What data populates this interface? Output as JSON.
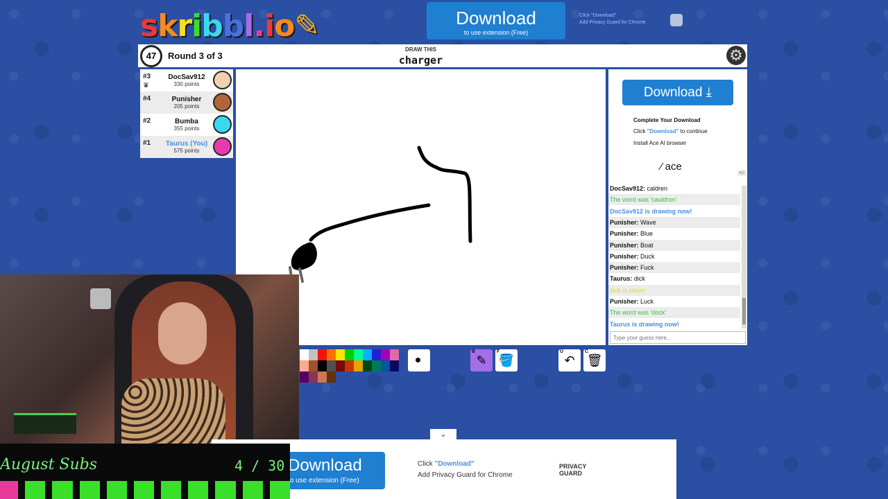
{
  "logo": {
    "letters": [
      {
        "ch": "s",
        "color": "#e83a3a"
      },
      {
        "ch": "k",
        "color": "#f58a1f"
      },
      {
        "ch": "r",
        "color": "#f5e11f"
      },
      {
        "ch": "i",
        "color": "#3adf2a"
      },
      {
        "ch": "b",
        "color": "#3ad7f0"
      },
      {
        "ch": "b",
        "color": "#4a6fe0"
      },
      {
        "ch": "l",
        "color": "#a46ee8"
      },
      {
        "ch": ".",
        "color": "#e83a9c"
      },
      {
        "ch": "i",
        "color": "#e83a3a"
      },
      {
        "ch": "o",
        "color": "#f58a1f"
      },
      {
        "ch": "✎",
        "color": "#f5b01f"
      }
    ]
  },
  "top_ad": {
    "button_label": "Download",
    "button_sub": "to use extension (Free)",
    "side_line1": "Click \"Download\"",
    "side_line2": "Add Privacy Guard for Chrome"
  },
  "header": {
    "timer": "47",
    "round": "Round 3 of 3",
    "draw_this": "DRAW THIS",
    "word": "charger",
    "settings_icon": "⚙"
  },
  "players": [
    {
      "rank": "#3",
      "name": "DocSav912",
      "points": "330 points",
      "avatar_color": "#f0d0b0",
      "you": false,
      "crown": true
    },
    {
      "rank": "#4",
      "name": "Punisher",
      "points": "205 points",
      "avatar_color": "#b0653a",
      "you": false,
      "crown": false
    },
    {
      "rank": "#2",
      "name": "Bumba",
      "points": "355 points",
      "avatar_color": "#3ad7f0",
      "you": false,
      "crown": false
    },
    {
      "rank": "#1",
      "name": "Taurus (You)",
      "points": "575 points",
      "avatar_color": "#e83ab0",
      "you": true,
      "crown": false
    }
  ],
  "right_ad": {
    "button_label": "Download ⤓",
    "complete": "Complete Your Download",
    "click_prefix": "Click ",
    "click_link": "\"Download\"",
    "click_suffix": " to continue",
    "install": "Install Ace AI browser",
    "brand": "⁄ ace",
    "ad_label": "AD"
  },
  "chat": [
    {
      "user": "DocSav912:",
      "text": " caldren",
      "style": "normal"
    },
    {
      "user": "",
      "text": "The word was 'cauldron'",
      "style": "green"
    },
    {
      "user": "",
      "text": "DocSav912 is drawing now!",
      "style": "blue"
    },
    {
      "user": "Punisher:",
      "text": " Wave",
      "style": "normal"
    },
    {
      "user": "Punisher:",
      "text": " Blue",
      "style": "normal"
    },
    {
      "user": "Punisher:",
      "text": " Boat",
      "style": "normal"
    },
    {
      "user": "Punisher:",
      "text": " Duck",
      "style": "normal"
    },
    {
      "user": "Punisher:",
      "text": " Fuck",
      "style": "normal"
    },
    {
      "user": "Taurus:",
      "text": " dick",
      "style": "normal"
    },
    {
      "user": "",
      "text": "dick is close!",
      "style": "yellow"
    },
    {
      "user": "Punisher:",
      "text": " Luck",
      "style": "normal"
    },
    {
      "user": "",
      "text": "The word was 'dock'",
      "style": "green"
    },
    {
      "user": "",
      "text": "Taurus is drawing now!",
      "style": "blue"
    }
  ],
  "guess_placeholder": "Type your guess here...",
  "palette": [
    "#ffffff",
    "#c1c1c1",
    "#ef130b",
    "#ff7100",
    "#ffe400",
    "#00cc00",
    "#00ff91",
    "#00b2ff",
    "#231fd3",
    "#a300ba",
    "#df69a7",
    "#ffac8e",
    "#a0522d",
    "#000000",
    "#505050",
    "#740b07",
    "#c23800",
    "#e8a200",
    "#004619",
    "#00785d",
    "#00569e",
    "#0e0865",
    "#550069",
    "#873554",
    "#cc774d",
    "#63300d"
  ],
  "tools": {
    "pen": {
      "key": "B",
      "icon": "✎"
    },
    "fill": {
      "key": "F",
      "icon": "🪣"
    },
    "undo": {
      "key": "U",
      "icon": "↶"
    },
    "clear": {
      "key": "C",
      "icon": "🗑"
    }
  },
  "subs": {
    "title": "August Subs",
    "count": "4 / 30",
    "filled": 4,
    "total": 30
  },
  "bottom_ad": {
    "chevron": "⌄",
    "button_label": "Download",
    "button_sub": "to use extension (Free)",
    "click_prefix": "Click ",
    "click_link": "\"Download\"",
    "add": "Add Privacy Guard for Chrome",
    "brand_line1": "PRIVACY",
    "brand_line2": "GUARD"
  }
}
